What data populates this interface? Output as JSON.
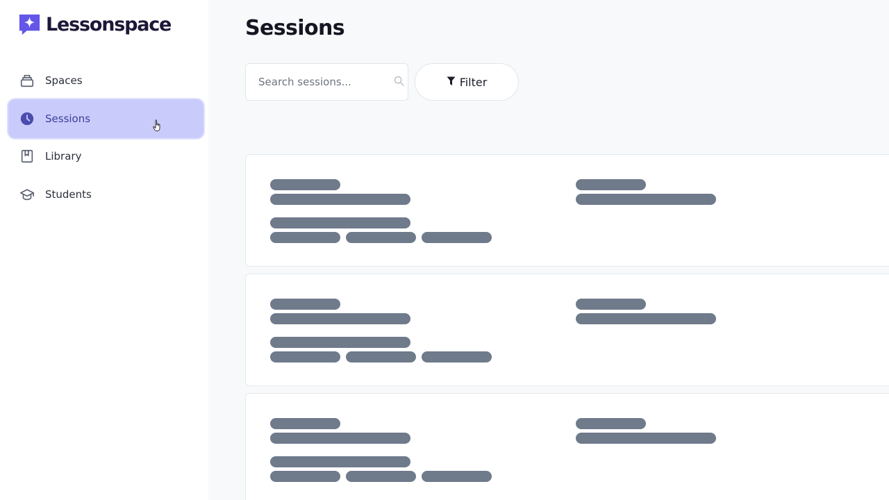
{
  "app": {
    "brand_name": "Lessonspace",
    "brand_color": "#6356e8"
  },
  "sidebar": {
    "items": [
      {
        "id": "spaces",
        "label": "Spaces",
        "icon": "layers-icon",
        "active": false
      },
      {
        "id": "sessions",
        "label": "Sessions",
        "icon": "clock-icon",
        "active": true
      },
      {
        "id": "library",
        "label": "Library",
        "icon": "book-icon",
        "active": false
      },
      {
        "id": "students",
        "label": "Students",
        "icon": "graduation-cap-icon",
        "active": false
      }
    ],
    "active_bg": "#c9ccfa"
  },
  "main": {
    "title": "Sessions",
    "search": {
      "placeholder": "Search sessions...",
      "value": ""
    },
    "filter": {
      "label": "Filter",
      "icon": "funnel-icon"
    }
  },
  "skeleton": {
    "color": "#6f7a8b"
  }
}
